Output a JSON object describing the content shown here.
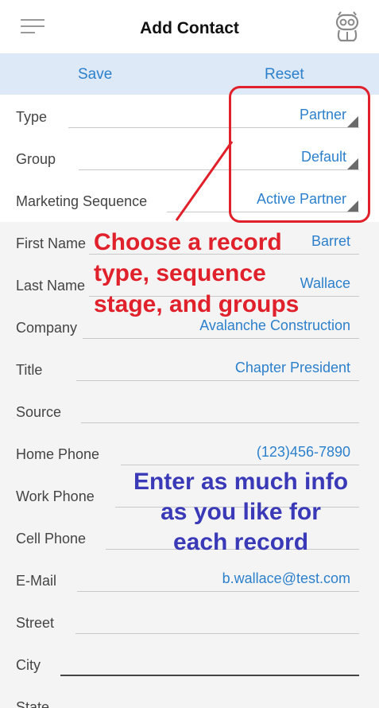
{
  "header": {
    "title": "Add Contact",
    "menu_icon": "hamburger-menu-icon",
    "robot_icon": "robot-icon"
  },
  "toolbar": {
    "save_label": "Save",
    "reset_label": "Reset"
  },
  "fields": {
    "type": {
      "label": "Type",
      "value": "Partner"
    },
    "group": {
      "label": "Group",
      "value": "Default"
    },
    "sequence": {
      "label": "Marketing Sequence",
      "value": "Active Partner"
    },
    "first_name": {
      "label": "First Name",
      "value": "Barret"
    },
    "last_name": {
      "label": "Last Name",
      "value": "Wallace"
    },
    "company": {
      "label": "Company",
      "value": "Avalanche Construction"
    },
    "title": {
      "label": "Title",
      "value": "Chapter President"
    },
    "source": {
      "label": "Source",
      "value": ""
    },
    "home_phone": {
      "label": "Home Phone",
      "value": "(123)456-7890"
    },
    "work_phone": {
      "label": "Work Phone",
      "value": ""
    },
    "cell_phone": {
      "label": "Cell Phone",
      "value": ""
    },
    "email": {
      "label": "E-Mail",
      "value": "b.wallace@test.com"
    },
    "street": {
      "label": "Street",
      "value": ""
    },
    "city": {
      "label": "City",
      "value": ""
    },
    "state": {
      "label": "State",
      "value": ""
    }
  },
  "annotations": {
    "red_1": "Choose a record",
    "red_2": "type, sequence",
    "red_3": "stage, and groups",
    "blue_1": "Enter as much info",
    "blue_2": "as you like for",
    "blue_3": "each record"
  },
  "colors": {
    "accent": "#2c80cc",
    "toolbar_bg": "#dde9f6",
    "annotation_red": "#e0202a",
    "annotation_blue": "#3a3ab8"
  }
}
